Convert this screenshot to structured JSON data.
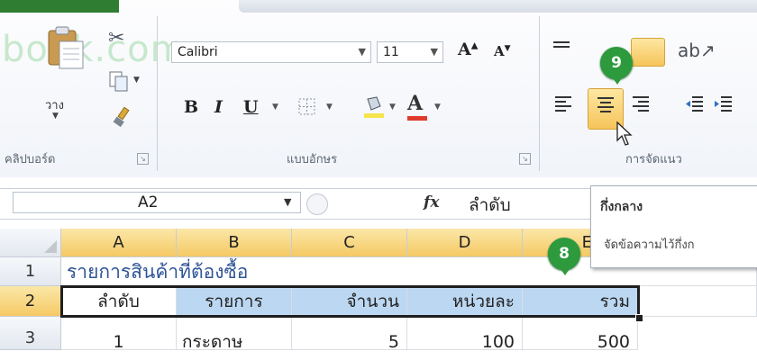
{
  "ribbon": {
    "watermark": "bodk.com",
    "clipboard": {
      "paste_label": "วาง",
      "group_label": "คลิปบอร์ด"
    },
    "font": {
      "name": "Calibri",
      "size": "11",
      "group_label": "แบบอักษร"
    },
    "alignment": {
      "group_label": "การจัดแนว"
    }
  },
  "callouts": {
    "nine": "9",
    "eight": "8"
  },
  "tooltip": {
    "title": "กึ่งกลาง",
    "description": "จัดข้อความไว้กึ่งก"
  },
  "formula_bar": {
    "name_box": "A2",
    "fx": "fx",
    "value": "ลำดับ"
  },
  "sheet": {
    "columns": [
      "A",
      "B",
      "C",
      "D",
      "E"
    ],
    "rows": [
      "1",
      "2",
      "3"
    ],
    "row1_title": "รายการสินค้าที่ต้องซื้อ",
    "headers": [
      "ลำดับ",
      "รายการ",
      "จำนวน",
      "หน่วยละ",
      "รวม"
    ],
    "row3": [
      "1",
      "กระดาษ",
      "5",
      "100",
      "500"
    ]
  },
  "colors": {
    "green_callout": "#2c9a3d",
    "header_blue": "#bcd7f1",
    "selected_header": "#f5c964"
  }
}
